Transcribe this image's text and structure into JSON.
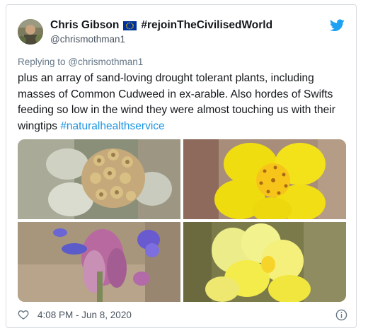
{
  "tweet": {
    "author_name": "Chris Gibson",
    "author_suffix": "#rejoinTheCivilisedWorld",
    "handle": "@chrismothman1",
    "replying_prefix": "Replying to",
    "replying_to": "@chrismothman1",
    "text": "plus an array of sand-loving drought tolerant plants, including masses of Common Cudweed in ex-arable. Also hordes of Swifts feeding so low in the wind they were almost touching us with their wingtips ",
    "hashtag": "#naturalhealthservice",
    "timestamp": "4:08 PM - Jun 8, 2020"
  },
  "colors": {
    "twitter_blue": "#1da1f2",
    "link_blue": "#1b95e0",
    "eu_blue": "#003399",
    "eu_star": "#ffcc00"
  },
  "icons": {
    "brand": "twitter-bird-icon",
    "like": "heart-icon",
    "info": "info-icon",
    "flag": "eu-flag-icon"
  },
  "media": [
    {
      "subject": "cudweed-flower-photo"
    },
    {
      "subject": "yellow-cinquefoil-photo"
    },
    {
      "subject": "purple-flower-photo"
    },
    {
      "subject": "yellow-toadflax-photo"
    }
  ]
}
